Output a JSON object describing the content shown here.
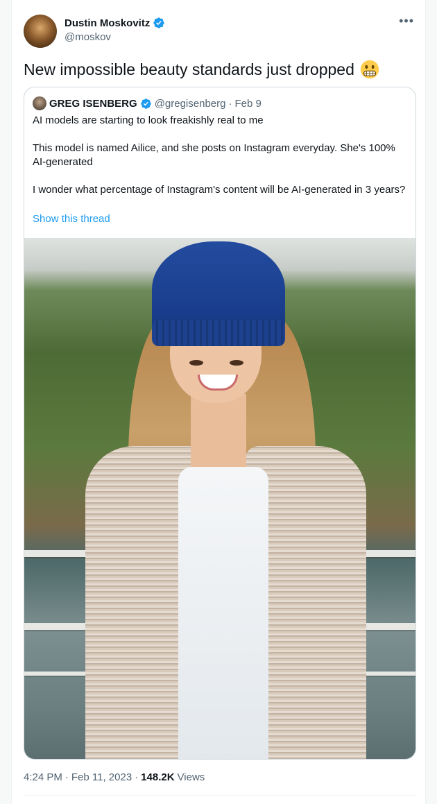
{
  "author": {
    "display_name": "Dustin Moskovitz",
    "handle": "@moskov",
    "verified": true,
    "more_icon": "more-horizontal-icon"
  },
  "tweet": {
    "text": "New impossible beauty standards just dropped",
    "emoji": "grimacing-face-emoji"
  },
  "quote": {
    "display_name": "GREG ISENBERG",
    "handle": "@gregisenberg",
    "separator": "·",
    "date": "Feb 9",
    "paragraphs": [
      "AI models are starting to look freakishly real to me",
      "This model is named Ailice, and she posts on Instagram everyday. She's 100% AI-generated",
      "I wonder what percentage of Instagram's content will be AI-generated in 3 years?"
    ],
    "show_thread": "Show this thread"
  },
  "meta": {
    "time": "4:24 PM",
    "separator": "·",
    "date": "Feb 11, 2023",
    "views_count": "148.2K",
    "views_label": "Views"
  },
  "colors": {
    "accent": "#1d9bf0",
    "text": "#0f1419",
    "secondary": "#536471"
  }
}
